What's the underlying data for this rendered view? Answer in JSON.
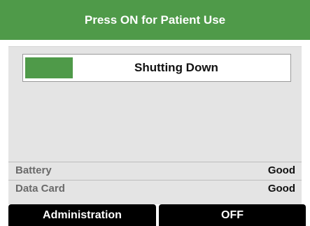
{
  "header": {
    "title": "Press ON for Patient Use"
  },
  "status": {
    "label": "Shutting Down",
    "progress_fraction": 0.18
  },
  "rows": [
    {
      "label": "Battery",
      "value": "Good"
    },
    {
      "label": "Data Card",
      "value": "Good"
    }
  ],
  "softkeys": {
    "left_label": "Administration",
    "right_label": "OFF"
  },
  "colors": {
    "accent": "#4f9a49",
    "screen_bg": "#e4e4e4",
    "softkey_bg": "#000000"
  }
}
